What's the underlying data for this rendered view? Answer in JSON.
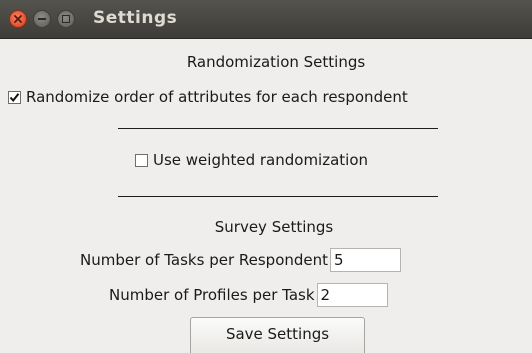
{
  "window": {
    "title": "Settings"
  },
  "randomization": {
    "heading": "Randomization Settings",
    "randomize_order": {
      "label": "Randomize order of attributes for each respondent",
      "checked": true
    },
    "weighted": {
      "label": "Use weighted randomization",
      "checked": false
    }
  },
  "survey": {
    "heading": "Survey Settings",
    "tasks": {
      "label": "Number of Tasks per Respondent",
      "value": "5"
    },
    "profiles": {
      "label": "Number of Profiles per Task",
      "value": "2"
    }
  },
  "actions": {
    "save_label": "Save Settings"
  },
  "icons": {
    "close": "close-icon",
    "minimize": "minimize-icon",
    "maximize": "maximize-icon",
    "check": "check-icon"
  },
  "colors": {
    "titlebar": "#3d3c38",
    "close_button": "#e0502e",
    "background": "#efeeec"
  }
}
